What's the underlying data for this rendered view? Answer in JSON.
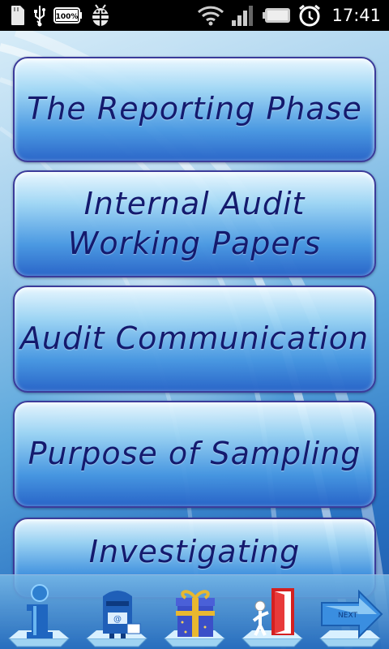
{
  "status_bar": {
    "battery_label": "100%",
    "time": "17:41",
    "icons": [
      "sd-card-icon",
      "usb-icon",
      "battery-full-icon",
      "android-debug-icon",
      "wifi-icon",
      "signal-icon",
      "battery-icon",
      "alarm-clock-icon"
    ]
  },
  "menu": {
    "items": [
      {
        "lines": [
          "The Reporting Phase"
        ]
      },
      {
        "lines": [
          "Internal Audit",
          "Working Papers"
        ]
      },
      {
        "lines": [
          "Audit Communication"
        ]
      },
      {
        "lines": [
          "Purpose of Sampling"
        ]
      },
      {
        "lines": [
          "Investigating"
        ]
      }
    ]
  },
  "toolbar": {
    "items": [
      {
        "icon": "info-icon",
        "label": ""
      },
      {
        "icon": "mailbox-icon",
        "label": ""
      },
      {
        "icon": "gift-icon",
        "label": ""
      },
      {
        "icon": "exit-door-icon",
        "label": ""
      },
      {
        "icon": "next-arrow-icon",
        "label": "NEXT"
      }
    ]
  },
  "colors": {
    "button_text": "#141a6e",
    "button_border": "#3b3b9a",
    "status_bar_bg": "#000000"
  }
}
